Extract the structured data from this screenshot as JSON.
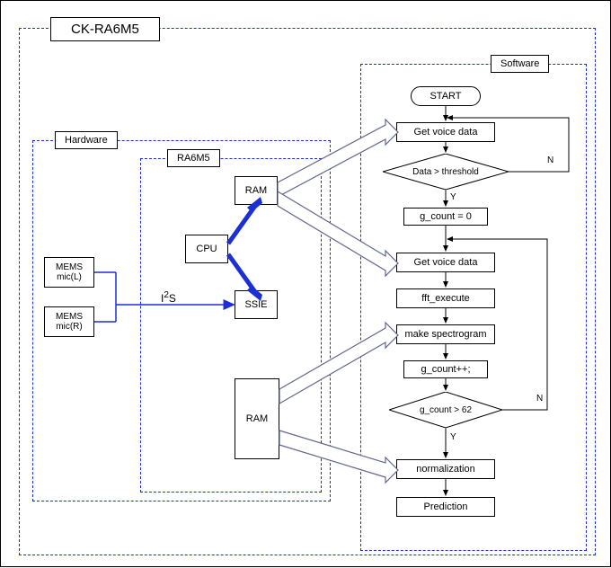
{
  "title": "CK-RA6M5",
  "groups": {
    "hardware": "Hardware",
    "ra6m5": "RA6M5",
    "software": "Software"
  },
  "hardware": {
    "mic_l": "MEMS\nmic(L)",
    "mic_r": "MEMS\nmic(R)",
    "bus": "I"
  },
  "bus_sup": "2",
  "bus_suffix": "S",
  "ra6m5": {
    "ram1": "RAM",
    "cpu": "CPU",
    "ssie": "SSIE",
    "ram2": "RAM"
  },
  "flow": {
    "start": "START",
    "get1": "Get voice data",
    "dec1": "Data > threshold",
    "gcount0": "g_count = 0",
    "get2": "Get voice data",
    "fft": "fft_execute",
    "spec": "make spectrogram",
    "inc": "g_count++;",
    "dec2": "g_count > 62",
    "norm": "normalization",
    "pred": "Prediction",
    "y": "Y",
    "n": "N"
  }
}
